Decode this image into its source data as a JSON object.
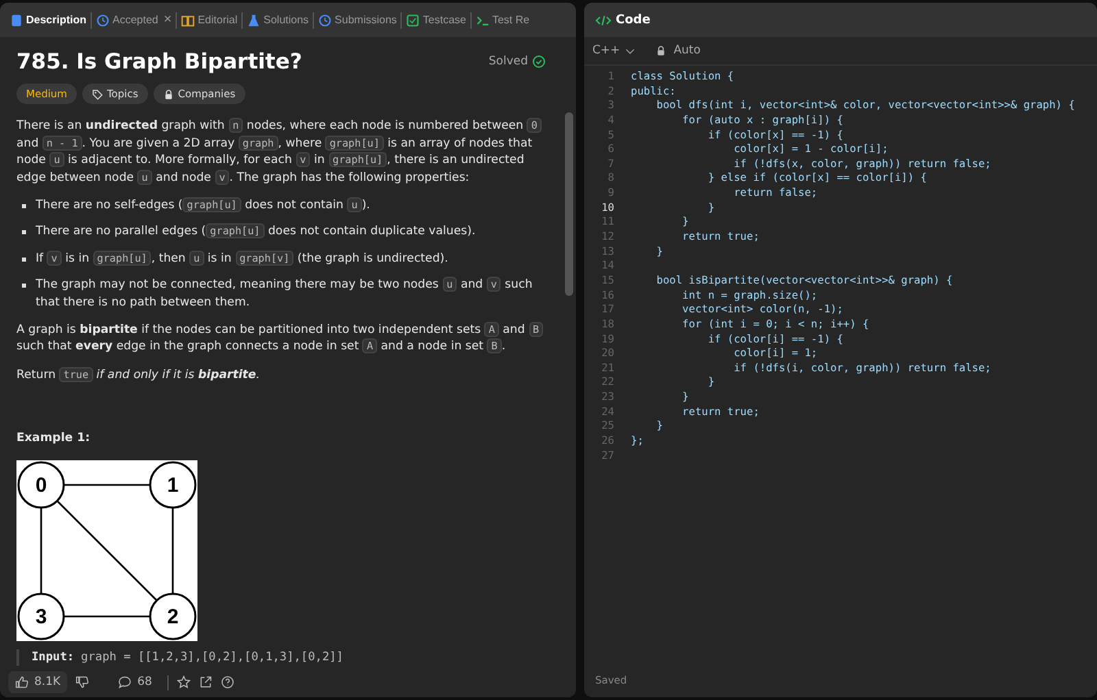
{
  "tabs": [
    {
      "label": "Description",
      "selected": true
    },
    {
      "label": "Accepted",
      "selected": false,
      "close": "×"
    },
    {
      "label": "Editorial",
      "selected": false
    },
    {
      "label": "Solutions",
      "selected": false
    },
    {
      "label": "Submissions",
      "selected": false
    },
    {
      "label": "Testcase",
      "selected": false
    },
    {
      "label": "Test Re",
      "selected": false
    }
  ],
  "problem": {
    "title": "785. Is Graph Bipartite?",
    "status": "Solved",
    "solved": true,
    "difficulty": "Medium",
    "tags": [
      {
        "label": "Topics"
      },
      {
        "label": "Companies"
      }
    ],
    "paragraphs": [
      [
        {
          "kind": "text",
          "text": "There is an **undirected** graph with "
        },
        {
          "kind": "code",
          "text": "n"
        },
        {
          "kind": "text",
          "text": " nodes, where each node is numbered between "
        },
        {
          "kind": "code",
          "text": "0"
        },
        {
          "kind": "text",
          "text": " and "
        },
        {
          "kind": "code",
          "text": "n - 1"
        },
        {
          "kind": "text",
          "text": ". You are given a 2D array "
        },
        {
          "kind": "code",
          "text": "graph"
        },
        {
          "kind": "text",
          "text": ", where "
        },
        {
          "kind": "code",
          "text": "graph[u]"
        },
        {
          "kind": "text",
          "text": " is an array of nodes that node "
        },
        {
          "kind": "code",
          "text": "u"
        },
        {
          "kind": "text",
          "text": " is adjacent to. More formally, for each "
        },
        {
          "kind": "code",
          "text": "v"
        },
        {
          "kind": "text",
          "text": " in "
        },
        {
          "kind": "code",
          "text": "graph[u]"
        },
        {
          "kind": "text",
          "text": ", there is an undirected edge between node "
        },
        {
          "kind": "code",
          "text": "u"
        },
        {
          "kind": "text",
          "text": " and node "
        },
        {
          "kind": "code",
          "text": "v"
        },
        {
          "kind": "text",
          "text": ". The graph has the following properties:"
        }
      ]
    ],
    "bullets": [
      [
        {
          "kind": "text",
          "text": "There are no self-edges ("
        },
        {
          "kind": "code",
          "text": "graph[u]"
        },
        {
          "kind": "text",
          "text": " does not contain "
        },
        {
          "kind": "code",
          "text": "u"
        },
        {
          "kind": "text",
          "text": ")."
        }
      ],
      [
        {
          "kind": "text",
          "text": "There are no parallel edges ("
        },
        {
          "kind": "code",
          "text": "graph[u]"
        },
        {
          "kind": "text",
          "text": " does not contain duplicate values)."
        }
      ],
      [
        {
          "kind": "text",
          "text": "If "
        },
        {
          "kind": "code",
          "text": "v"
        },
        {
          "kind": "text",
          "text": " is in "
        },
        {
          "kind": "code",
          "text": "graph[u]"
        },
        {
          "kind": "text",
          "text": ", then "
        },
        {
          "kind": "code",
          "text": "u"
        },
        {
          "kind": "text",
          "text": " is in "
        },
        {
          "kind": "code",
          "text": "graph[v]"
        },
        {
          "kind": "text",
          "text": " (the graph is undirected)."
        }
      ],
      [
        {
          "kind": "text",
          "text": "The graph may not be connected, meaning there may be two nodes "
        },
        {
          "kind": "code",
          "text": "u"
        },
        {
          "kind": "text",
          "text": " and "
        },
        {
          "kind": "code",
          "text": "v"
        },
        {
          "kind": "text",
          "text": " such that there is no path between them."
        }
      ]
    ],
    "after": [
      [
        {
          "kind": "text",
          "text": "A graph is **bipartite** if the nodes can be partitioned into two independent sets "
        },
        {
          "kind": "code",
          "text": "A"
        },
        {
          "kind": "text",
          "text": " and "
        },
        {
          "kind": "code",
          "text": "B"
        },
        {
          "kind": "text",
          "text": " such that **every** edge in the graph connects a node in set "
        },
        {
          "kind": "code",
          "text": "A"
        },
        {
          "kind": "text",
          "text": " and a node in set "
        },
        {
          "kind": "code",
          "text": "B"
        },
        {
          "kind": "text",
          "text": "."
        }
      ],
      [
        {
          "kind": "text",
          "text": "Return "
        },
        {
          "kind": "code",
          "text": "true"
        },
        {
          "kind": "em",
          "text": " if and only if it is **bipartite**."
        }
      ]
    ],
    "example_title": "Example 1:",
    "graph": {
      "nodes": [
        "0",
        "1",
        "3",
        "2"
      ]
    },
    "input_label": "Input:",
    "input_value": "graph = [[1,2,3],[0,2],[0,1,3],[0,2]]"
  },
  "footer": {
    "likes": "8.1K",
    "comments": "68"
  },
  "editor": {
    "title": "Code",
    "language": "C++",
    "mode": "Auto",
    "status": "Saved",
    "lines": [
      {
        "number": "1",
        "text": "class Solution {",
        "current": false
      },
      {
        "number": "2",
        "text": "public:",
        "current": false
      },
      {
        "number": "3",
        "text": "    bool dfs(int i, vector<int>& color, vector<vector<int>>& graph) {",
        "current": false
      },
      {
        "number": "4",
        "text": "        for (auto x : graph[i]) {",
        "current": false
      },
      {
        "number": "5",
        "text": "            if (color[x] == -1) {",
        "current": false
      },
      {
        "number": "6",
        "text": "                color[x] = 1 - color[i];",
        "current": false
      },
      {
        "number": "7",
        "text": "                if (!dfs(x, color, graph)) return false;",
        "current": false
      },
      {
        "number": "8",
        "text": "            } else if (color[x] == color[i]) {",
        "current": false
      },
      {
        "number": "9",
        "text": "                return false;",
        "current": false
      },
      {
        "number": "10",
        "text": "            }",
        "current": true
      },
      {
        "number": "11",
        "text": "        }",
        "current": false
      },
      {
        "number": "12",
        "text": "        return true;",
        "current": false
      },
      {
        "number": "13",
        "text": "    }",
        "current": false
      },
      {
        "number": "14",
        "current": false
      },
      {
        "number": "15",
        "text": "    bool isBipartite(vector<vector<int>>& graph) {",
        "current": false
      },
      {
        "number": "16",
        "text": "        int n = graph.size();",
        "current": false
      },
      {
        "number": "17",
        "text": "        vector<int> color(n, -1);",
        "current": false
      },
      {
        "number": "18",
        "text": "        for (int i = 0; i < n; i++) {",
        "current": false
      },
      {
        "number": "19",
        "text": "            if (color[i] == -1) {",
        "current": false
      },
      {
        "number": "20",
        "text": "                color[i] = 1;",
        "current": false
      },
      {
        "number": "21",
        "text": "                if (!dfs(i, color, graph)) return false;",
        "current": false
      },
      {
        "number": "22",
        "text": "            }",
        "current": false
      },
      {
        "number": "23",
        "text": "        }",
        "current": false
      },
      {
        "number": "24",
        "text": "        return true;",
        "current": false
      },
      {
        "number": "25",
        "text": "    }",
        "current": false
      },
      {
        "number": "26",
        "text": "};",
        "current": false
      },
      {
        "number": "27",
        "current": false
      }
    ]
  }
}
